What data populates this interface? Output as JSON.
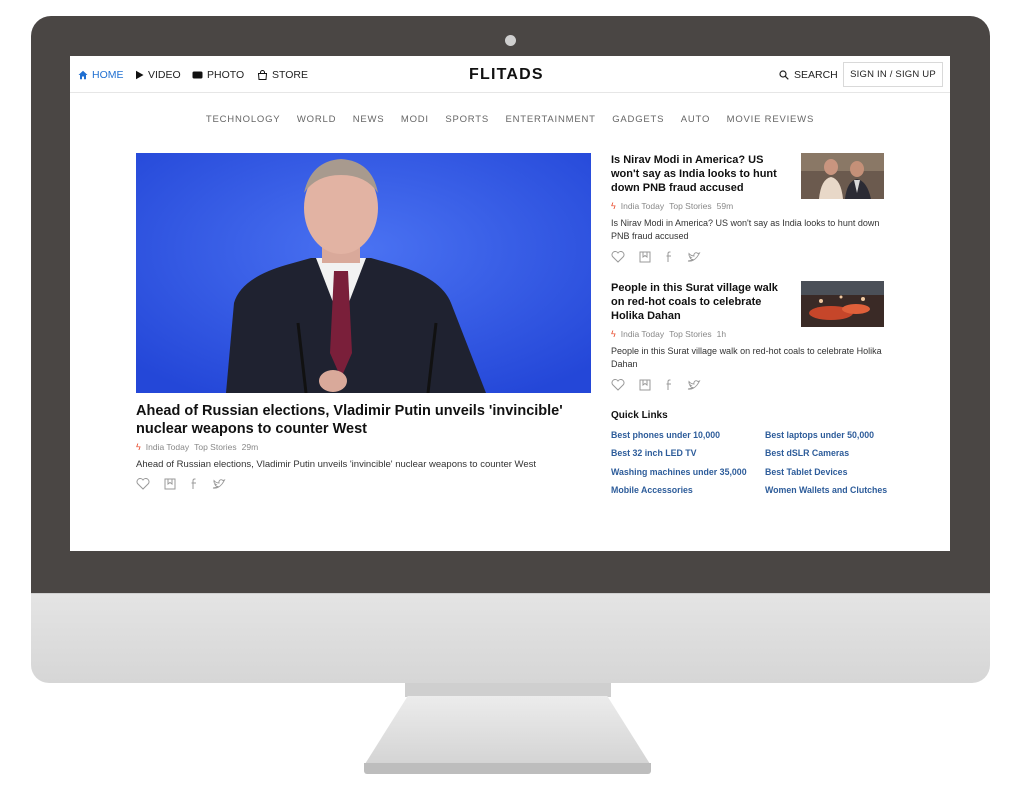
{
  "nav": {
    "home": "HOME",
    "video": "VIDEO",
    "photo": "PHOTO",
    "store": "STORE",
    "logo": "FLITADS",
    "search": "SEARCH",
    "signin": "SIGN IN / SIGN UP",
    "accent_color": "#1f6fd1"
  },
  "categories": [
    "TECHNOLOGY",
    "WORLD",
    "NEWS",
    "MODI",
    "SPORTS",
    "ENTERTAINMENT",
    "GADGETS",
    "AUTO",
    "MOVIE REVIEWS"
  ],
  "hero": {
    "title": "Ahead of Russian elections, Vladimir Putin unveils 'invincible' nuclear weapons to counter West",
    "source": "India Today",
    "section": "Top Stories",
    "time": "29m",
    "description": "Ahead of Russian elections, Vladimir Putin unveils 'invincible' nuclear weapons to counter West"
  },
  "stories": [
    {
      "title": "Is Nirav Modi in America? US won't say as India looks to hunt down PNB fraud accused",
      "source": "India Today",
      "section": "Top Stories",
      "time": "59m",
      "description": "Is Nirav Modi in America? US won't say as India looks to hunt down PNB fraud accused"
    },
    {
      "title": "People in this Surat village walk on red-hot coals to celebrate Holika Dahan",
      "source": "India Today",
      "section": "Top Stories",
      "time": "1h",
      "description": "People in this Surat village walk on red-hot coals to celebrate Holika Dahan"
    }
  ],
  "quick_links": {
    "title": "Quick Links",
    "items": [
      "Best phones under 10,000",
      "Best laptops under 50,000",
      "Best 32 inch LED TV",
      "Best dSLR Cameras",
      "Washing machines under 35,000",
      "Best Tablet Devices",
      "Mobile Accessories",
      "Women Wallets and Clutches"
    ],
    "link_color": "#2d5c9a"
  }
}
